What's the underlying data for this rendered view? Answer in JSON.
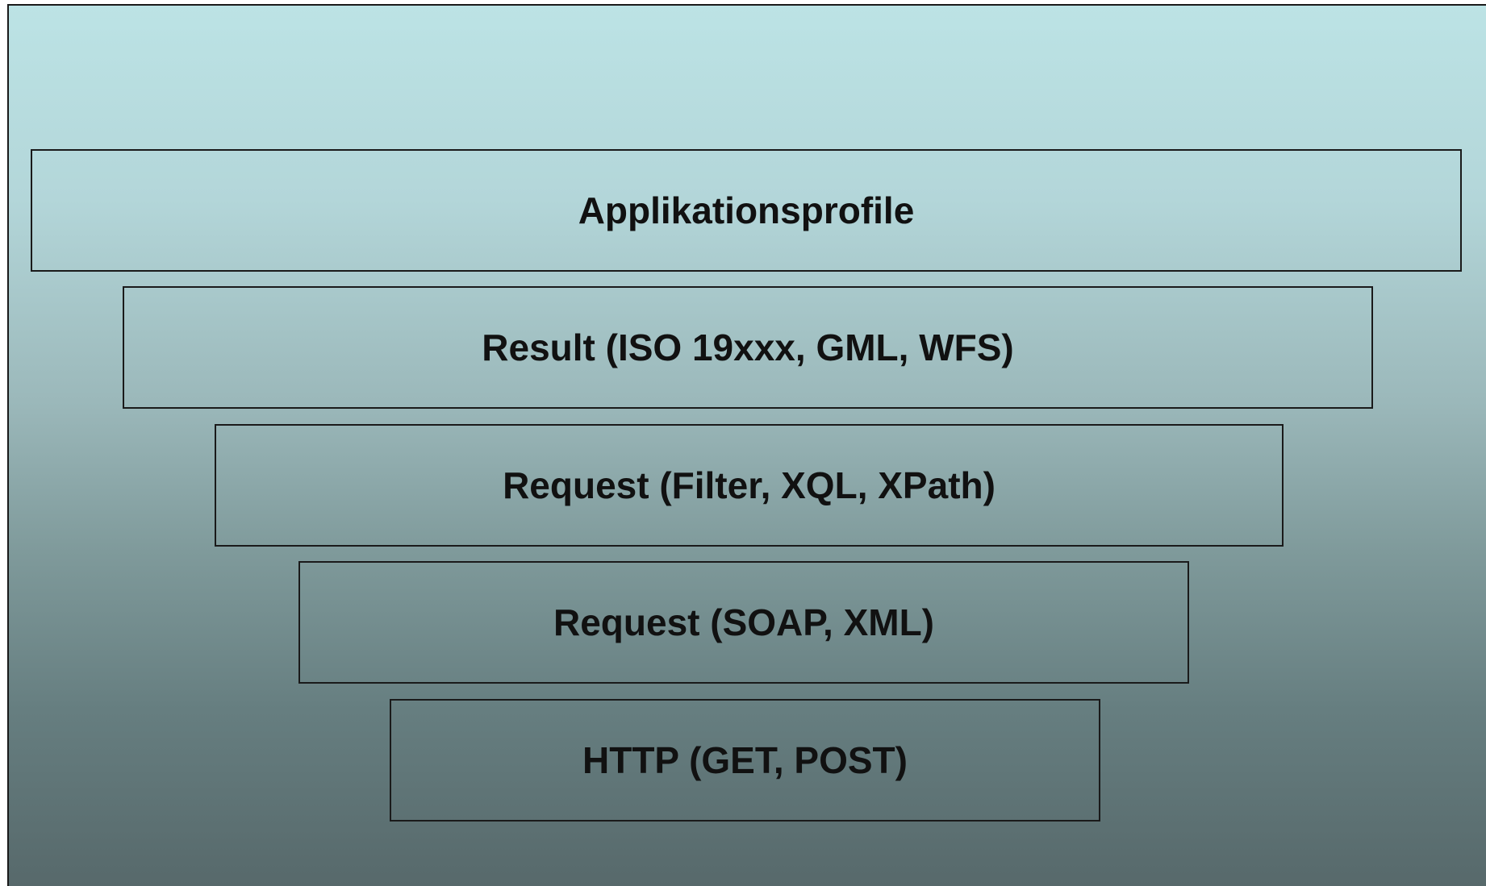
{
  "diagram": {
    "layers": [
      {
        "label": "Applikationsprofile"
      },
      {
        "label": "Result (ISO 19xxx, GML, WFS)"
      },
      {
        "label": "Request (Filter, XQL, XPath)"
      },
      {
        "label": "Request (SOAP, XML)"
      },
      {
        "label": "HTTP (GET, POST)"
      }
    ]
  },
  "colors": {
    "background_top": "#bce3e5",
    "background_bottom": "#57696b",
    "border": "#1a1a1a",
    "text": "#111111"
  }
}
